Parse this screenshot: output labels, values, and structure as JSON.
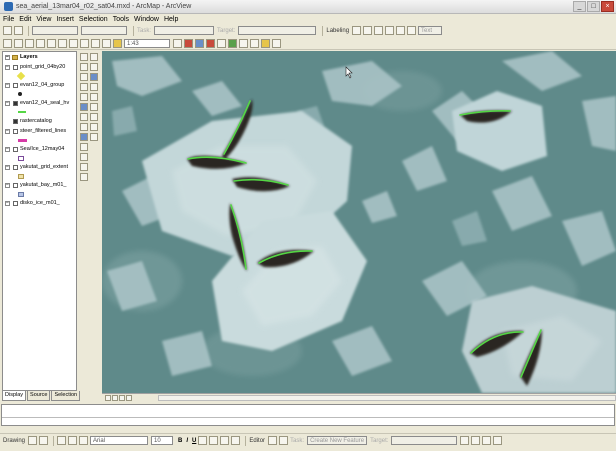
{
  "window": {
    "title": "sea_aerial_13mar04_r02_sat04.mxd - ArcMap - ArcView"
  },
  "menu": [
    "File",
    "Edit",
    "View",
    "Insert",
    "Selection",
    "Tools",
    "Window",
    "Help"
  ],
  "toolbar": {
    "target_layer": "",
    "scale": "1:43",
    "editor_label": "Labeling",
    "task": "",
    "target": "Text"
  },
  "toc": {
    "root": "Layers",
    "layers": [
      {
        "name": "point_grid_04by20",
        "checked": false
      },
      {
        "name": "evan12_04_group",
        "checked": false
      },
      {
        "name": "evan12_04_seal_hv",
        "checked": true
      },
      {
        "name": "rastercatalog",
        "checked": true
      },
      {
        "name": "steer_filtered_lines",
        "checked": false
      },
      {
        "name": "Sea/Ice_12may04",
        "checked": false
      },
      {
        "name": "yakutat_grid_extent",
        "checked": false
      },
      {
        "name": "yakutat_bay_m01_",
        "checked": false
      },
      {
        "name": "disko_ice_m01_",
        "checked": false
      }
    ],
    "tabs": [
      "Display",
      "Source",
      "Selection"
    ]
  },
  "drawing": {
    "label": "Drawing",
    "font": "Arial",
    "size": "10",
    "bold": "B",
    "italic": "I",
    "underline": "U",
    "editor": "Editor",
    "create_task": "Create New Feature"
  },
  "colors": {
    "seal_trace": "#55d645",
    "seal_body": "#2c2523",
    "water": "#5f8a8a",
    "ice": "#b9d0d3"
  }
}
